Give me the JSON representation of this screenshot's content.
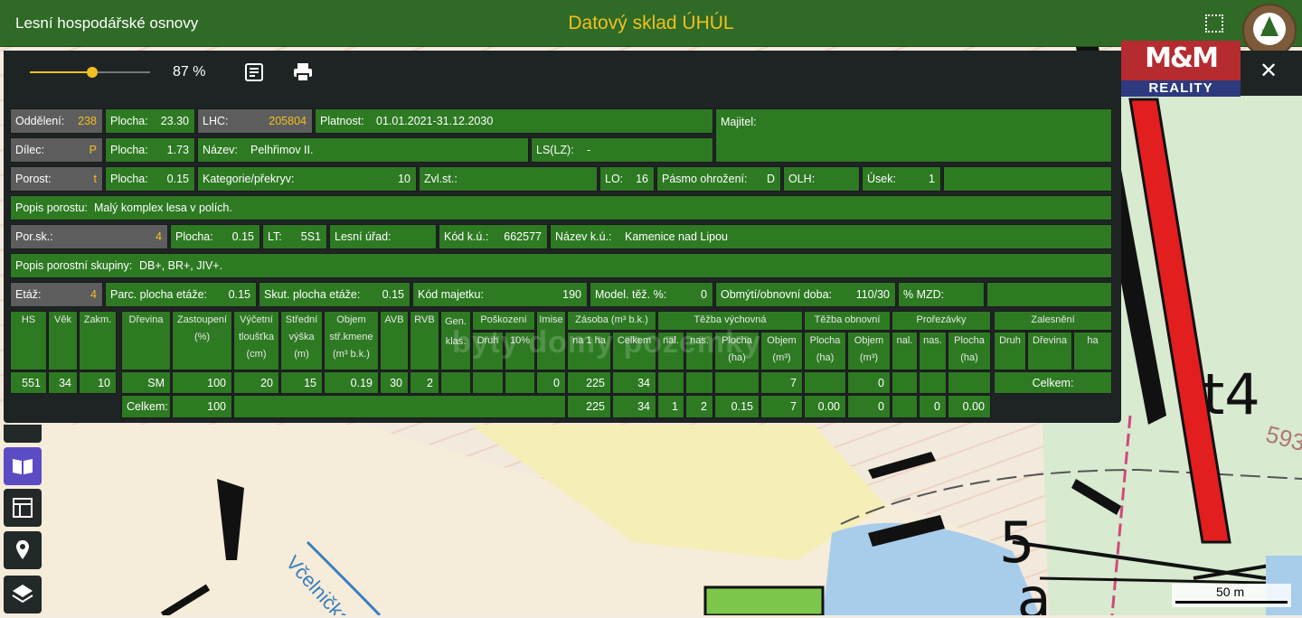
{
  "header": {
    "app_title": "Lesní hospodářské osnovy",
    "center_title": "Datový sklad ÚHÚL",
    "logo_text": "ÚHÚL"
  },
  "ad_logo": {
    "top": "M&M",
    "bottom": "REALITY"
  },
  "toolbar": {
    "zoom_label": "87 %",
    "zoom_value": 0.52,
    "notes_icon": "notes-icon",
    "print_icon": "print-icon",
    "close_label": "✕"
  },
  "detail": {
    "oddeleni": {
      "label": "Oddělení:",
      "value": "238"
    },
    "plocha1": {
      "label": "Plocha:",
      "value": "23.30"
    },
    "lhc": {
      "label": "LHC:",
      "value": "205804"
    },
    "platnost": {
      "label": "Platnost:",
      "value": "01.01.2021-31.12.2030"
    },
    "majitel": {
      "label": "Majitel:"
    },
    "dilec": {
      "label": "Dílec:",
      "value": "P"
    },
    "plocha2": {
      "label": "Plocha:",
      "value": "1.73"
    },
    "nazev": {
      "label": "Název:",
      "value": "Pelhřimov II."
    },
    "ls": {
      "label": "LS(LZ):",
      "value": "-"
    },
    "porost": {
      "label": "Porost:",
      "value": "t"
    },
    "plocha3": {
      "label": "Plocha:",
      "value": "0.15"
    },
    "kategorie": {
      "label": "Kategorie/překryv:",
      "value": "10"
    },
    "zvlst": {
      "label": "Zvl.st.:"
    },
    "lo": {
      "label": "LO:",
      "value": "16"
    },
    "pasmo": {
      "label": "Pásmo ohrožení:",
      "value": "D"
    },
    "olh": {
      "label": "OLH:"
    },
    "usek": {
      "label": "Úsek:",
      "value": "1"
    },
    "popis_porostu": {
      "label": "Popis porostu:",
      "value": "Malý komplex lesa v polích."
    },
    "porsk": {
      "label": "Por.sk.:",
      "value": "4"
    },
    "plocha4": {
      "label": "Plocha:",
      "value": "0.15"
    },
    "lt": {
      "label": "LT:",
      "value": "5S1"
    },
    "lesni_urad": {
      "label": "Lesní úřad:"
    },
    "kod_ku": {
      "label": "Kód k.ú.:",
      "value": "662577"
    },
    "nazev_ku": {
      "label": "Název k.ú.:",
      "value": "Kamenice nad Lipou"
    },
    "popis_skupiny": {
      "label": "Popis porostní skupiny:",
      "value": "DB+, BR+, JIV+."
    },
    "etaz": {
      "label": "Etáž:",
      "value": "4"
    },
    "parc_plocha": {
      "label": "Parc. plocha etáže:",
      "value": "0.15"
    },
    "skut_plocha": {
      "label": "Skut. plocha etáže:",
      "value": "0.15"
    },
    "kod_majetku": {
      "label": "Kód majetku:",
      "value": "190"
    },
    "model_tez": {
      "label": "Model. těž. %:",
      "value": "0"
    },
    "obmyti": {
      "label": "Obmýtí/obnovní doba:",
      "value": "110/30"
    },
    "mzd": {
      "label": "% MZD:"
    }
  },
  "table": {
    "h": {
      "hs": "HS",
      "vek": "Věk",
      "zakm": "Zakm.",
      "drevina": "Dřevina",
      "zastoupeni": "Zastoupení",
      "zast_unit": "(%)",
      "vycetni": "Výčetní",
      "tloustka": "tloušťka",
      "cm": "(cm)",
      "stredni": "Střední",
      "vyska": "výška",
      "m": "(m)",
      "objem": "Objem",
      "strkmene": "stř.kmene",
      "m3bk": "(m³ b.k.)",
      "avb": "AVB",
      "rvb": "RVB",
      "gen": "Gen.",
      "klas": "klas.",
      "poskozeni": "Poškození",
      "druh": "Druh",
      "pct10": "10%",
      "imise": "Imise",
      "zasoba": "Zásoba (m³ b.k.)",
      "na1ha": "na 1 ha",
      "celkem": "Celkem",
      "tezba_vych": "Těžba výchovná",
      "nal": "nal.",
      "nas": "nas.",
      "plocha": "Plocha",
      "ha_unit": "(ha)",
      "objem2": "Objem",
      "m3": "(m³)",
      "tezba_obn": "Těžba obnovní",
      "prorezavky": "Prořezávky",
      "zalesneni": "Zalesnění",
      "drevina2": "Dřevina",
      "ha": "ha",
      "celkem_label": "Celkem:"
    },
    "row": {
      "hs": "551",
      "vek": "34",
      "zakm": "10",
      "drevina": "SM",
      "zastoupeni": "100",
      "tloustka": "20",
      "vyska": "15",
      "objem": "0.19",
      "avb": "30",
      "rvb": "2",
      "imise": "0",
      "na1ha": "225",
      "celkem": "34",
      "tv_objem": "7",
      "to_objem": "0"
    },
    "total": {
      "zastoupeni": "100",
      "na1ha": "225",
      "celkem": "34",
      "tv_nal": "1",
      "tv_nas": "2",
      "tv_plocha": "0.15",
      "tv_objem": "7",
      "to_plocha": "0.00",
      "to_objem": "0",
      "pr_nas": "0",
      "pr_plocha": "0.00"
    }
  },
  "map": {
    "label_t4": "t4",
    "label_5a": "5a",
    "label_593": "593",
    "label_stream": "Včelnička",
    "scale_label": "50 m"
  },
  "watermark": "byty domy pozemky"
}
